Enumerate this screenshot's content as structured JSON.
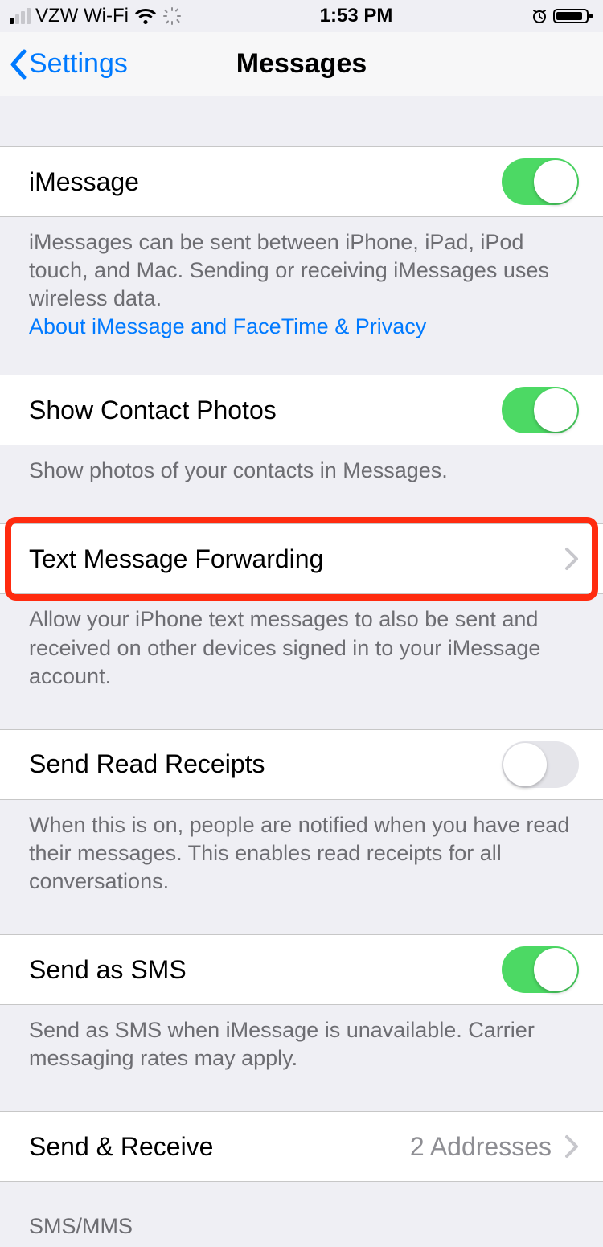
{
  "status": {
    "carrier": "VZW Wi-Fi",
    "time": "1:53 PM"
  },
  "nav": {
    "back": "Settings",
    "title": "Messages"
  },
  "rows": {
    "imessage": {
      "label": "iMessage",
      "on": true
    },
    "imessage_footer": "iMessages can be sent between iPhone, iPad, iPod touch, and Mac. Sending or receiving iMessages uses wireless data.",
    "imessage_link": "About iMessage and FaceTime & Privacy",
    "contact_photos": {
      "label": "Show Contact Photos",
      "on": true
    },
    "contact_photos_footer": "Show photos of your contacts in Messages.",
    "forwarding": {
      "label": "Text Message Forwarding"
    },
    "forwarding_footer": "Allow your iPhone text messages to also be sent and received on other devices signed in to your iMessage account.",
    "read_receipts": {
      "label": "Send Read Receipts",
      "on": false
    },
    "read_receipts_footer": "When this is on, people are notified when you have read their messages. This enables read receipts for all conversations.",
    "send_sms": {
      "label": "Send as SMS",
      "on": true
    },
    "send_sms_footer": "Send as SMS when iMessage is unavailable. Carrier messaging rates may apply.",
    "send_receive": {
      "label": "Send & Receive",
      "detail": "2 Addresses"
    },
    "sms_mms_header": "SMS/MMS"
  }
}
